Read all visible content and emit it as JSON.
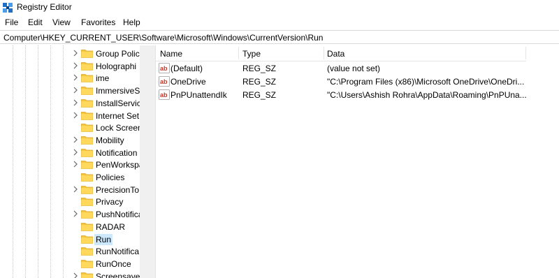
{
  "window": {
    "title": "Registry Editor",
    "app_icon": "registry-editor-icon"
  },
  "menu": [
    "File",
    "Edit",
    "View",
    "Favorites",
    "Help"
  ],
  "address": "Computer\\HKEY_CURRENT_USER\\Software\\Microsoft\\Windows\\CurrentVersion\\Run",
  "tree": {
    "items": [
      {
        "label": "Group Polic",
        "expandable": true
      },
      {
        "label": "Holographi",
        "expandable": true
      },
      {
        "label": "ime",
        "expandable": true
      },
      {
        "label": "ImmersiveS",
        "expandable": true
      },
      {
        "label": "InstallServic",
        "expandable": true
      },
      {
        "label": "Internet Set",
        "expandable": true
      },
      {
        "label": "Lock Screen",
        "expandable": false
      },
      {
        "label": "Mobility",
        "expandable": true
      },
      {
        "label": "Notification",
        "expandable": true
      },
      {
        "label": "PenWorkspa",
        "expandable": true
      },
      {
        "label": "Policies",
        "expandable": false
      },
      {
        "label": "PrecisionTo",
        "expandable": true
      },
      {
        "label": "Privacy",
        "expandable": false
      },
      {
        "label": "PushNotifica",
        "expandable": true
      },
      {
        "label": "RADAR",
        "expandable": false
      },
      {
        "label": "Run",
        "expandable": false,
        "selected": true
      },
      {
        "label": "RunNotifica",
        "expandable": false
      },
      {
        "label": "RunOnce",
        "expandable": false
      },
      {
        "label": "Screensaver",
        "expandable": true
      }
    ],
    "folder_color": "#f5c542"
  },
  "columns": {
    "name": "Name",
    "type": "Type",
    "data": "Data"
  },
  "values": [
    {
      "name": "(Default)",
      "type": "REG_SZ",
      "data": "(value not set)"
    },
    {
      "name": "OneDrive",
      "type": "REG_SZ",
      "data": "\"C:\\Program Files (x86)\\Microsoft OneDrive\\OneDri..."
    },
    {
      "name": "PnPUnattendIk",
      "type": "REG_SZ",
      "data": "\"C:\\Users\\Ashish Rohra\\AppData\\Roaming\\PnPUna..."
    }
  ],
  "colors": {
    "selection": "#cce8ff",
    "reg_icon_red": "#c0392b"
  }
}
